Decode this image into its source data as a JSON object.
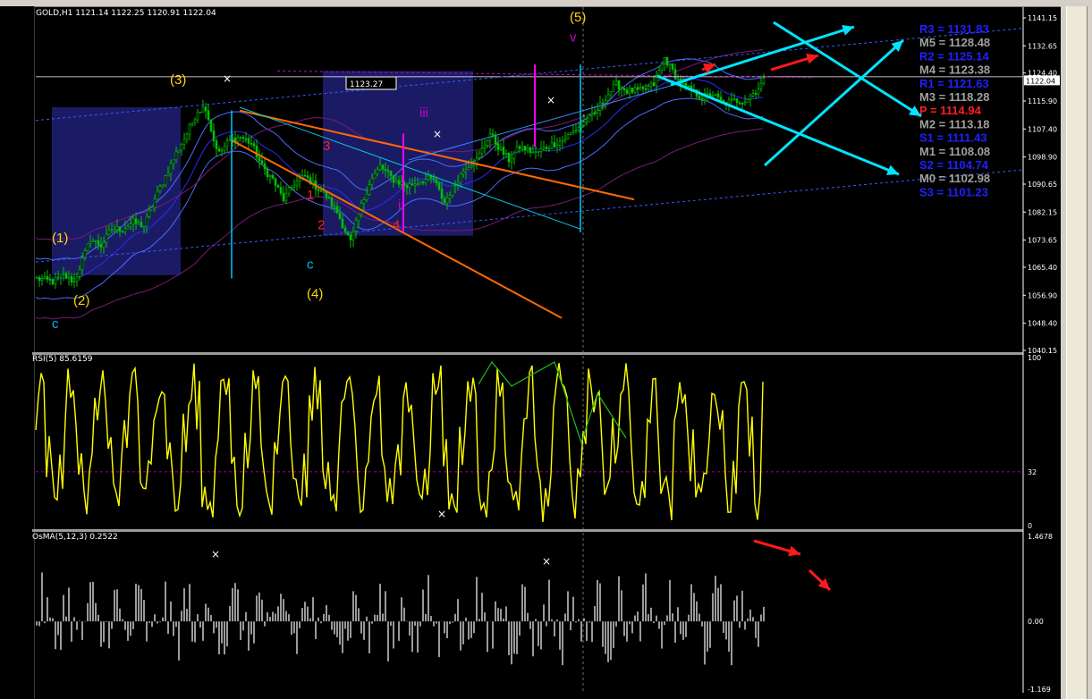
{
  "header": {
    "symbol_line": "GOLD,H1  1121.14 1122.25 1120.91 1122.04",
    "rsi_label": "RSI(5) 85.6159",
    "osma_label": "OsMA(5,12,3) 0.2522",
    "crosshair_value": "1123.27"
  },
  "colors": {
    "background": "#000000",
    "candles": "#00c000",
    "rsi": "#ffff00",
    "osma": "#c0c0c0",
    "box": "#1c1c6a",
    "channel": "#ff6a00",
    "arrows_cyan": "#00e5ff",
    "arrows_red": "#ff1a1a",
    "wave_yellow": "#ffd700",
    "wave_red": "#ff2020",
    "wave_cyan": "#00b4ff",
    "wave_magenta": "#cc00cc"
  },
  "chart_data": [
    {
      "type": "candlestick",
      "panel": "price",
      "price_axis_ticks": [
        "1141.15",
        "1132.65",
        "1124.40",
        "1115.90",
        "1107.40",
        "1098.90",
        "1090.65",
        "1082.15",
        "1073.65",
        "1065.40",
        "1056.90",
        "1048.40",
        "1040.15"
      ],
      "ylim": [
        1040.15,
        1141.15
      ],
      "last_price": "1122.04",
      "close_path": [
        [
          0,
          1062
        ],
        [
          6,
          1061
        ],
        [
          10,
          1063
        ],
        [
          14,
          1061
        ],
        [
          20,
          1074
        ],
        [
          24,
          1072
        ],
        [
          28,
          1077
        ],
        [
          32,
          1077
        ],
        [
          36,
          1079
        ],
        [
          40,
          1078
        ],
        [
          44,
          1086
        ],
        [
          48,
          1093
        ],
        [
          52,
          1100
        ],
        [
          56,
          1106
        ],
        [
          60,
          1113
        ],
        [
          63,
          1114
        ],
        [
          66,
          1104
        ],
        [
          68,
          1100
        ],
        [
          72,
          1104
        ],
        [
          76,
          1105
        ],
        [
          80,
          1103
        ],
        [
          84,
          1096
        ],
        [
          88,
          1092
        ],
        [
          92,
          1086
        ],
        [
          96,
          1091
        ],
        [
          100,
          1093
        ],
        [
          104,
          1090
        ],
        [
          108,
          1087
        ],
        [
          112,
          1082
        ],
        [
          117,
          1073
        ],
        [
          121,
          1084
        ],
        [
          124,
          1091
        ],
        [
          128,
          1096
        ],
        [
          133,
          1092
        ],
        [
          138,
          1090
        ],
        [
          144,
          1092
        ],
        [
          148,
          1092
        ],
        [
          152,
          1085
        ],
        [
          156,
          1091
        ],
        [
          160,
          1096
        ],
        [
          164,
          1098
        ],
        [
          169,
          1106
        ],
        [
          172,
          1102
        ],
        [
          176,
          1098
        ],
        [
          180,
          1102
        ],
        [
          186,
          1100
        ],
        [
          190,
          1102
        ],
        [
          196,
          1104
        ],
        [
          202,
          1108
        ],
        [
          208,
          1112
        ],
        [
          212,
          1117
        ],
        [
          216,
          1121
        ],
        [
          220,
          1119
        ],
        [
          226,
          1119
        ],
        [
          230,
          1121
        ],
        [
          234,
          1129
        ],
        [
          240,
          1121
        ],
        [
          244,
          1119
        ],
        [
          248,
          1117
        ],
        [
          252,
          1118
        ],
        [
          256,
          1115
        ],
        [
          260,
          1116
        ],
        [
          264,
          1116
        ],
        [
          268,
          1119
        ],
        [
          271,
          1122
        ]
      ],
      "x_span_bars": 271,
      "price_points": {
        "right_channel_top": 1134,
        "right_channel_bottom": 1104,
        "lower_channel_start": 1115,
        "lower_channel_end": 1096
      },
      "zones": [
        {
          "from_bar": 6,
          "to_bar": 54,
          "low": 1063,
          "high": 1114
        },
        {
          "from_bar": 107,
          "to_bar": 163,
          "low": 1075,
          "high": 1125
        }
      ],
      "horizontal_line": 1123.27,
      "pivots": [
        {
          "label": "R3",
          "value": "1131.83",
          "kind": "resistance"
        },
        {
          "label": "M5",
          "value": "1128.48",
          "kind": "mid"
        },
        {
          "label": "R2",
          "value": "1125.14",
          "kind": "resistance"
        },
        {
          "label": "M4",
          "value": "1123.38",
          "kind": "mid"
        },
        {
          "label": "R1",
          "value": "1121.63",
          "kind": "resistance"
        },
        {
          "label": "M3",
          "value": "1118.28",
          "kind": "mid"
        },
        {
          "label": "P",
          "value": "1114.94",
          "kind": "pivot"
        },
        {
          "label": "M2",
          "value": "1113.18",
          "kind": "mid"
        },
        {
          "label": "S1",
          "value": "1111.43",
          "kind": "support"
        },
        {
          "label": "M1",
          "value": "1108.08",
          "kind": "mid"
        },
        {
          "label": "S2",
          "value": "1104.74",
          "kind": "support"
        },
        {
          "label": "M0",
          "value": "1102.98",
          "kind": "mid"
        },
        {
          "label": "S3",
          "value": "1101.23",
          "kind": "support"
        }
      ],
      "wave_labels": [
        {
          "text": "(1)",
          "bar": 8,
          "price": 1073,
          "color": "wave_yellow"
        },
        {
          "text": "(2)",
          "bar": 16,
          "price": 1054,
          "color": "wave_yellow"
        },
        {
          "text": "c",
          "bar": 8,
          "price": 1047,
          "color": "wave_cyan"
        },
        {
          "text": "(3)",
          "bar": 52,
          "price": 1121,
          "color": "wave_yellow"
        },
        {
          "text": "1",
          "bar": 103,
          "price": 1086,
          "color": "wave_red"
        },
        {
          "text": "2",
          "bar": 107,
          "price": 1077,
          "color": "wave_red"
        },
        {
          "text": "3",
          "bar": 109,
          "price": 1101,
          "color": "wave_red"
        },
        {
          "text": "4",
          "bar": 135,
          "price": 1077,
          "color": "wave_red"
        },
        {
          "text": "c",
          "bar": 103,
          "price": 1065,
          "color": "wave_cyan"
        },
        {
          "text": "(4)",
          "bar": 103,
          "price": 1056,
          "color": "wave_yellow"
        },
        {
          "text": "iii",
          "bar": 145,
          "price": 1111,
          "color": "wave_magenta"
        },
        {
          "text": "ii",
          "bar": 137,
          "price": 1083,
          "color": "wave_magenta"
        },
        {
          "text": "(5)",
          "bar": 201,
          "price": 1140,
          "color": "wave_yellow"
        },
        {
          "text": "v",
          "bar": 201,
          "price": 1134,
          "color": "wave_magenta"
        }
      ]
    },
    {
      "type": "line",
      "panel": "rsi",
      "axis_ticks": [
        "100",
        "32",
        "0"
      ],
      "ylim": [
        0,
        100
      ],
      "level_line": 32,
      "last_value": 85.6159
    },
    {
      "type": "bar",
      "panel": "osma",
      "axis_ticks": [
        "1.4678",
        "0.00",
        "-1.169"
      ],
      "ylim": [
        -1.169,
        1.4678
      ],
      "last_value": 0.2522
    }
  ]
}
